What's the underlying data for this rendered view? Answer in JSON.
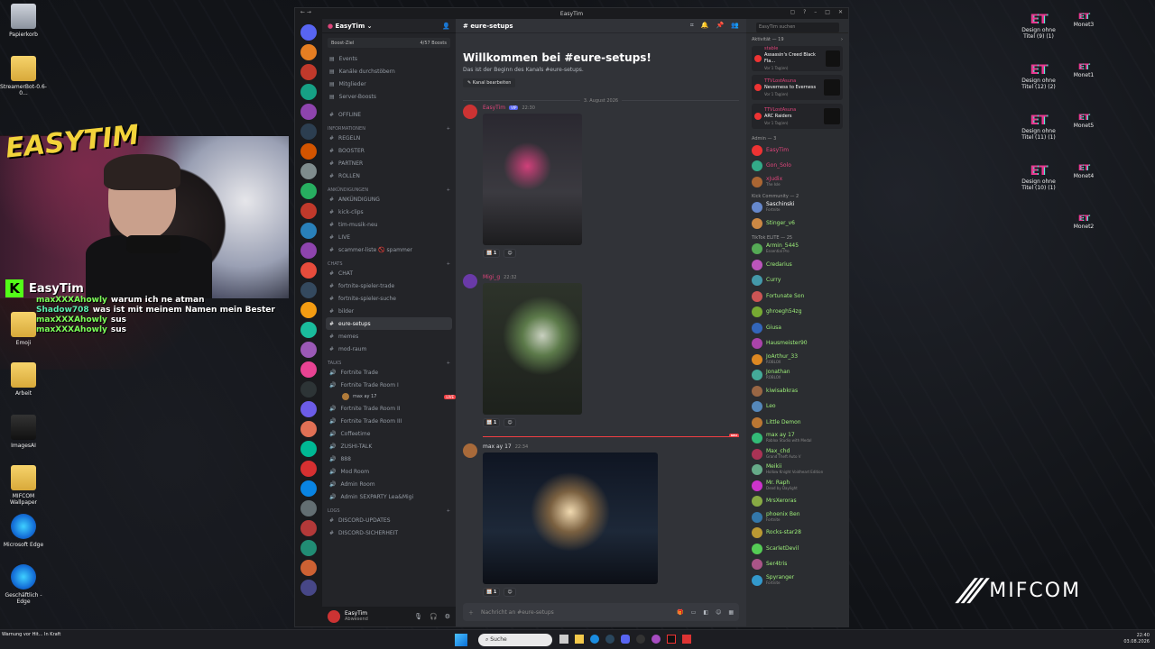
{
  "desktop_left": [
    {
      "label": "Papierkorb",
      "type": "bin"
    },
    {
      "label": "StreamerBot-0.6-0...",
      "type": "folder"
    },
    {
      "label": "Emoji",
      "type": "folder"
    },
    {
      "label": "Arbeit",
      "type": "folder"
    },
    {
      "label": "ImagesAI",
      "type": "img"
    },
    {
      "label": "MIFCOM Wallpaper",
      "type": "folder"
    },
    {
      "label": "Microsoft Edge",
      "type": "edge"
    },
    {
      "label": "Geschäftlich - Edge",
      "type": "edge"
    }
  ],
  "desktop_right": [
    {
      "label": "Design ohne Titel (9) (1)"
    },
    {
      "label": "Monet3"
    },
    {
      "label": "Design ohne Titel (12) (2)"
    },
    {
      "label": "Monet1"
    },
    {
      "label": "Design ohne Titel (11) (1)"
    },
    {
      "label": "Monet5"
    },
    {
      "label": "Design ohne Titel (10) (1)"
    },
    {
      "label": "Monet4"
    },
    {
      "label": "Monet2"
    }
  ],
  "overlay": {
    "logo": "EASYTIM",
    "kick_name": "EasyTim",
    "chat": [
      {
        "user": "maxXXXAhowly",
        "msg": "warum ich ne atman"
      },
      {
        "user": "Shadow708",
        "msg": "was ist mit meinem Namen mein Bester"
      },
      {
        "user": "maxXXXAhowly",
        "msg": "sus"
      },
      {
        "user": "maxXXXAhowly",
        "msg": "sus"
      }
    ],
    "brand": "MIFCOM"
  },
  "discord": {
    "title": "EasyTim",
    "server_name": "EasyTim",
    "boost_goal": "Boost-Ziel",
    "boost_count": "4/57 Boosts",
    "top_items": [
      "Events",
      "Kanäle durchstöbern",
      "Mitglieder",
      "Server-Boosts"
    ],
    "channels": [
      {
        "kind": "ch",
        "label": "OFFLINE"
      },
      {
        "kind": "cat",
        "label": "INFORMATIONEN"
      },
      {
        "kind": "ch",
        "label": "REGELN"
      },
      {
        "kind": "ch",
        "label": "BOOSTER"
      },
      {
        "kind": "ch",
        "label": "PARTNER"
      },
      {
        "kind": "ch",
        "label": "ROLLEN"
      },
      {
        "kind": "cat",
        "label": "ANKÜNDIGUNGEN"
      },
      {
        "kind": "ch",
        "label": "ANKÜNDIGUNG"
      },
      {
        "kind": "ch",
        "label": "kick-clips"
      },
      {
        "kind": "ch",
        "label": "tim-musik-neu"
      },
      {
        "kind": "ch",
        "label": "LIVE"
      },
      {
        "kind": "ch",
        "label": "scammer-liste 🚫 spammer"
      },
      {
        "kind": "cat",
        "label": "CHATS"
      },
      {
        "kind": "ch",
        "label": "CHAT"
      },
      {
        "kind": "ch",
        "label": "fortnite-spieler-trade"
      },
      {
        "kind": "ch",
        "label": "fortnite-spieler-suche"
      },
      {
        "kind": "ch",
        "label": "bilder"
      },
      {
        "kind": "act",
        "label": "eure-setups"
      },
      {
        "kind": "ch",
        "label": "memes"
      },
      {
        "kind": "ch",
        "label": "mod-raum"
      },
      {
        "kind": "cat",
        "label": "TALKS"
      },
      {
        "kind": "ch",
        "label": "Fortnite Trade"
      },
      {
        "kind": "ch",
        "label": "Fortnite Trade Room I"
      },
      {
        "kind": "sub",
        "label": "max ay 17"
      },
      {
        "kind": "ch",
        "label": "Fortnite Trade Room II"
      },
      {
        "kind": "ch",
        "label": "Fortnite Trade Room III"
      },
      {
        "kind": "ch",
        "label": "Coffeetime"
      },
      {
        "kind": "ch",
        "label": "ZUSHI-TALK"
      },
      {
        "kind": "ch",
        "label": "888"
      },
      {
        "kind": "ch",
        "label": "Mod Room"
      },
      {
        "kind": "ch",
        "label": "Admin Room"
      },
      {
        "kind": "ch",
        "label": "Admin SEXPARTY Lea&Migi"
      },
      {
        "kind": "cat",
        "label": "LOGS"
      },
      {
        "kind": "ch",
        "label": "DISCORD-UPDATES"
      },
      {
        "kind": "ch",
        "label": "DISCORD-SICHERHEIT"
      }
    ],
    "live_badge": "LIVE",
    "user": {
      "name": "EasyTim",
      "status": "Abwesend"
    },
    "channel_header": "eure-setups",
    "welcome_title": "Willkommen bei #eure-setups!",
    "welcome_desc": "Das ist der Beginn des Kanals #eure-setups.",
    "edit_channel": "Kanal bearbeiten",
    "date_divider": "3. August 2026",
    "messages": [
      {
        "author": "EasyTim",
        "badge": "VIP",
        "time": "22:30",
        "color": "#e0457b",
        "reaction": "1"
      },
      {
        "author": "Migi_g",
        "time": "22:32",
        "color": "#e0457b",
        "reaction": "1"
      },
      {
        "author": "max ay 17",
        "time": "22:34",
        "color": "#dcdde1",
        "reaction": "1"
      }
    ],
    "new_label": "NEU",
    "compose_placeholder": "Nachricht an #eure-setups",
    "search_placeholder": "EasyTim suchen",
    "activity_title": "Aktivität — 19",
    "activities": [
      {
        "user": "stable",
        "game": "Assassin's Creed Black Fla...",
        "meta": "Vor 1 Tag(en)"
      },
      {
        "user": "TTVLostAsuna",
        "game": "Neverness to Everness",
        "meta": "Vor 1 Tag(en)"
      },
      {
        "user": "TTVLostAsuna",
        "game": "ARC Raiders",
        "meta": "Vor 1 Tag(en)"
      }
    ],
    "member_groups": [
      {
        "title": "Admin — 3",
        "members": [
          {
            "name": "EasyTim",
            "color": "#e0457b",
            "sub": ""
          },
          {
            "name": "Gon_Solo",
            "color": "#e0457b",
            "sub": ""
          },
          {
            "name": "xJudix",
            "color": "#e0457b",
            "sub": "The Isle"
          }
        ]
      },
      {
        "title": "Kick Community — 2",
        "members": [
          {
            "name": "Saschinski",
            "color": "#fff",
            "sub": "Fortnite"
          },
          {
            "name": "Stinger_v6",
            "color": "#9ef07a",
            "sub": ""
          }
        ]
      },
      {
        "title": "TikTok ELITE — 25",
        "members": [
          {
            "name": "Armin_5445",
            "color": "#9ef07a",
            "sub": "Essential Pro"
          },
          {
            "name": "Credarius",
            "color": "#9ef07a",
            "sub": ""
          },
          {
            "name": "Curry",
            "color": "#9ef07a",
            "sub": ""
          },
          {
            "name": "Fortunate Son",
            "color": "#9ef07a",
            "sub": ""
          },
          {
            "name": "ghroegh54zg",
            "color": "#9ef07a",
            "sub": ""
          },
          {
            "name": "Giusa",
            "color": "#9ef07a",
            "sub": ""
          },
          {
            "name": "Hausmeister90",
            "color": "#9ef07a",
            "sub": ""
          },
          {
            "name": "JoArthur_33",
            "color": "#9ef07a",
            "sub": "ROBLOX"
          },
          {
            "name": "Jonathan",
            "color": "#9ef07a",
            "sub": "ROBLOX"
          },
          {
            "name": "kiwisabkras",
            "color": "#9ef07a",
            "sub": ""
          },
          {
            "name": "Leo",
            "color": "#9ef07a",
            "sub": ""
          },
          {
            "name": "Little Demon",
            "color": "#9ef07a",
            "sub": ""
          },
          {
            "name": "max ay 17",
            "color": "#9ef07a",
            "sub": "Roblox Studio with Medal"
          },
          {
            "name": "Max_chd",
            "color": "#9ef07a",
            "sub": "Grand Theft Auto V"
          },
          {
            "name": "Meikii",
            "color": "#9ef07a",
            "sub": "Hollow Knight Voidheart Edition"
          },
          {
            "name": "Mr. Raph",
            "color": "#9ef07a",
            "sub": "Dead by Daylight"
          },
          {
            "name": "MrsXeroras",
            "color": "#9ef07a",
            "sub": ""
          },
          {
            "name": "phoenix Ben",
            "color": "#9ef07a",
            "sub": "Fortnite"
          },
          {
            "name": "Rocks-star28",
            "color": "#9ef07a",
            "sub": ""
          },
          {
            "name": "ScarletDevil",
            "color": "#9ef07a",
            "sub": ""
          },
          {
            "name": "Ser4tris",
            "color": "#9ef07a",
            "sub": ""
          },
          {
            "name": "Spyranger",
            "color": "#9ef07a",
            "sub": "Fortnite"
          }
        ]
      }
    ]
  },
  "taskbar": {
    "search": "Suche",
    "notification": "Warnung vor Hit... In Kraft",
    "time": "22:40",
    "date": "03.08.2026"
  }
}
